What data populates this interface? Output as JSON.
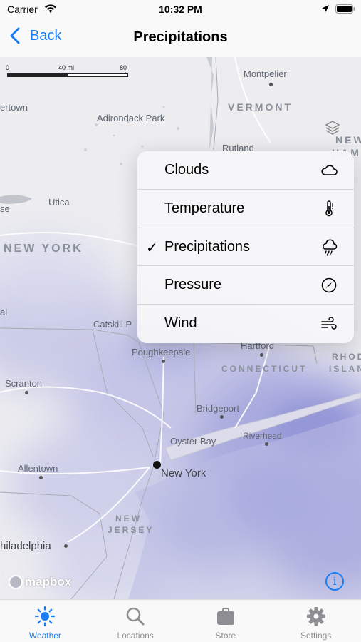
{
  "status_bar": {
    "carrier": "Carrier",
    "time": "10:32 PM"
  },
  "nav": {
    "back_label": "Back",
    "title": "Precipitations"
  },
  "map": {
    "scale": {
      "start": "0",
      "mid": "40 mi",
      "end": "80 mi"
    },
    "labels": {
      "montpelier": "Montpelier",
      "vermont": "VERMONT",
      "adirondack": "Adirondack Park",
      "rutland": "Rutland",
      "utica": "Utica",
      "new_york_state": "NEW YORK",
      "catskill": "Catskill P",
      "hartford": "Hartford",
      "poughkeepsie": "Poughkeepsie",
      "connecticut": "CONNECTICUT",
      "rhode": "RHOD",
      "island": "ISLAN",
      "new_h1": "NEW",
      "new_h2": "HAMPSH",
      "scranton": "Scranton",
      "bridgeport": "Bridgeport",
      "oyster_bay": "Oyster Bay",
      "riverhead": "Riverhead",
      "allentown": "Allentown",
      "new_york_city": "New York",
      "new_jersey_1": "NEW",
      "new_jersey_2": "JERSEY",
      "philadelphia": "hiladelphia",
      "ertown": "ertown",
      "se": "se",
      "al": "al"
    },
    "attribution": "mapbox",
    "info_glyph": "i"
  },
  "layer_menu": {
    "items": [
      {
        "label": "Clouds",
        "icon": "cloud-icon",
        "checked": false
      },
      {
        "label": "Temperature",
        "icon": "thermometer-icon",
        "checked": false
      },
      {
        "label": "Precipitations",
        "icon": "cloud-rain-icon",
        "checked": true
      },
      {
        "label": "Pressure",
        "icon": "gauge-icon",
        "checked": false
      },
      {
        "label": "Wind",
        "icon": "wind-icon",
        "checked": false
      }
    ],
    "check_glyph": "✓"
  },
  "tabs": [
    {
      "label": "Weather",
      "icon": "sun-icon",
      "active": true
    },
    {
      "label": "Locations",
      "icon": "magnifier-icon",
      "active": false
    },
    {
      "label": "Store",
      "icon": "bag-icon",
      "active": false
    },
    {
      "label": "Settings",
      "icon": "gear-icon",
      "active": false
    }
  ],
  "colors": {
    "accent": "#1a7ef2",
    "precip": "#8b8fd6",
    "inactive_tab": "#8e8e93"
  }
}
